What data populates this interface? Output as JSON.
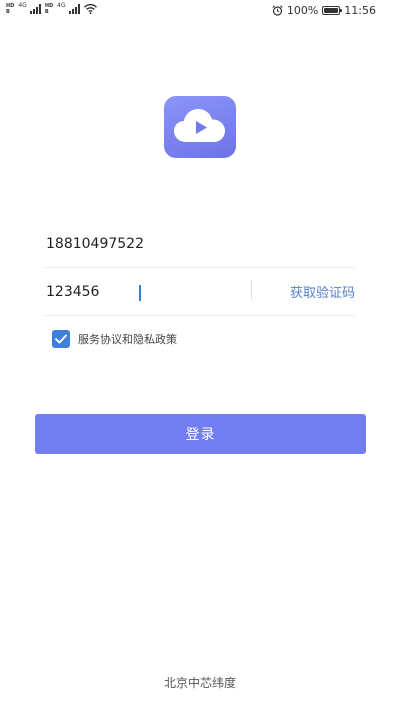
{
  "status_bar": {
    "sim1_tags": [
      "HD",
      "B"
    ],
    "sim1_network": "4G",
    "sim2_tags": [
      "HD",
      "B"
    ],
    "sim2_network": "4G",
    "battery_percent": "100%",
    "battery_level": 1.0,
    "time": "11:56"
  },
  "login_form": {
    "phone_value": "18810497522",
    "code_value": "123456",
    "get_code_label": "获取验证码",
    "agreement_label": "服务协议和隐私政策",
    "agreement_checked": true,
    "login_label": "登录"
  },
  "footer": {
    "company": "北京中芯纬度"
  },
  "colors": {
    "accent": "#727df0",
    "link": "#5580c8",
    "checkbox": "#3d7fda",
    "logo_gradient_start": "#8b95f8",
    "logo_gradient_end": "#6d73e8"
  },
  "icons": {
    "logo": "cloud-play-icon",
    "alarm": "alarm-clock-icon",
    "wifi": "wifi-icon",
    "battery": "battery-icon",
    "checkbox": "check-icon"
  }
}
